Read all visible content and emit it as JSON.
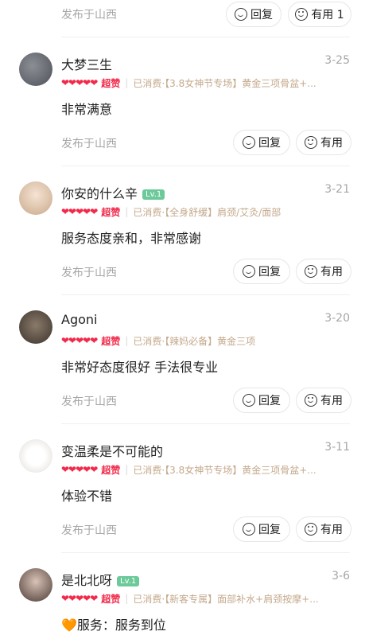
{
  "top": {
    "location": "发布于山西",
    "reply_label": "回复",
    "helpful_label": "有用 1"
  },
  "reviews": [
    {
      "name": "大梦三生",
      "level": "",
      "date": "3-25",
      "hearts": "❤❤❤❤❤",
      "rating_label": "超赞",
      "consume": "已消费·【3.8女神节专场】黄金三项骨盆+...",
      "content": "非常满意",
      "location": "发布于山西",
      "reply_label": "回复",
      "helpful_label": "有用"
    },
    {
      "name": "你安的什么辛",
      "level": "Lv.1",
      "date": "3-21",
      "hearts": "❤❤❤❤❤",
      "rating_label": "超赞",
      "consume": "已消费·【全身舒缓】肩颈/艾灸/面部",
      "content": "服务态度亲和，非常感谢",
      "location": "发布于山西",
      "reply_label": "回复",
      "helpful_label": "有用"
    },
    {
      "name": "Agoni",
      "level": "",
      "date": "3-20",
      "hearts": "❤❤❤❤❤",
      "rating_label": "超赞",
      "consume": "已消费·【辣妈必备】黄金三项",
      "content": "非常好态度很好 手法很专业",
      "location": "发布于山西",
      "reply_label": "回复",
      "helpful_label": "有用"
    },
    {
      "name": "变温柔是不可能的",
      "level": "",
      "date": "3-11",
      "hearts": "❤❤❤❤❤",
      "rating_label": "超赞",
      "consume": "已消费·【3.8女神节专场】黄金三项骨盆+...",
      "content": "体验不错",
      "location": "发布于山西",
      "reply_label": "回复",
      "helpful_label": "有用"
    },
    {
      "name": "是北北呀",
      "level": "Lv.1",
      "date": "3-6",
      "hearts": "❤❤❤❤❤",
      "rating_label": "超赞",
      "consume": "已消费·【新客专属】面部补水+肩颈按摩+...",
      "content": "🧡服务：服务到位",
      "location": "",
      "reply_label": "",
      "helpful_label": ""
    }
  ]
}
